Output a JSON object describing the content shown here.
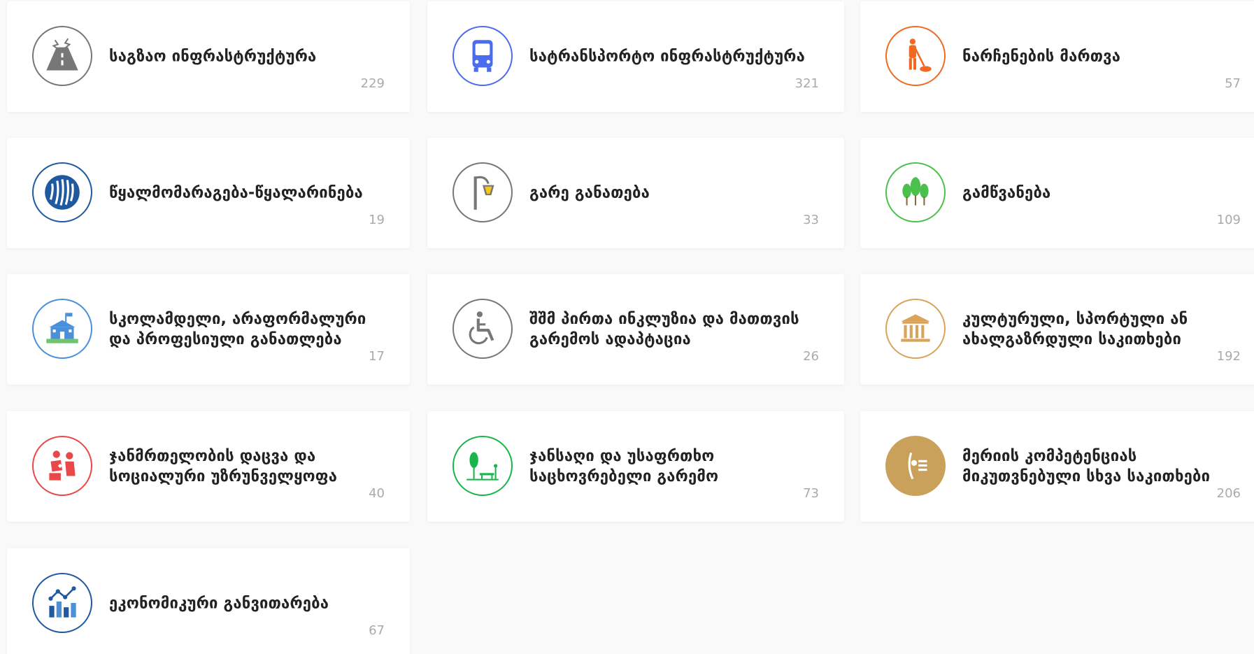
{
  "categories": [
    {
      "label": "საგზაო ინფრასტრუქტურა",
      "count": "229",
      "icon": "road-icon",
      "color": "#777777"
    },
    {
      "label": "სატრანსპორტო ინფრასტრუქტურა",
      "count": "321",
      "icon": "bus-icon",
      "color": "#4a6cf0"
    },
    {
      "label": "ნარჩენების მართვა",
      "count": "57",
      "icon": "janitor-icon",
      "color": "#f26a21"
    },
    {
      "label": "წყალმომარაგება-წყალარინება",
      "count": "19",
      "icon": "water-icon",
      "color": "#1f5aa0"
    },
    {
      "label": "გარე განათება",
      "count": "33",
      "icon": "street-lamp-icon",
      "color": "#777777"
    },
    {
      "label": "გამწვანება",
      "count": "109",
      "icon": "trees-icon",
      "color": "#4cc04c"
    },
    {
      "label": "სკოლამდელი, არაფორმალური და პროფესიული განათლება",
      "count": "17",
      "icon": "school-icon",
      "color": "#4a90d9"
    },
    {
      "label": "შშმ პირთა ინკლუზია და მათთვის გარემოს ადაპტაცია",
      "count": "26",
      "icon": "wheelchair-icon",
      "color": "#777777"
    },
    {
      "label": "კულტურული, სპორტული ან ახალგაზრდული საკითხები",
      "count": "192",
      "icon": "museum-icon",
      "color": "#d9a45a"
    },
    {
      "label": "ჯანმრთელობის დაცვა და სოციალური უზრუნველყოფა",
      "count": "40",
      "icon": "care-icon",
      "color": "#e84848"
    },
    {
      "label": "ჯანსაღი და უსაფრთხო საცხოვრებელი გარემო",
      "count": "73",
      "icon": "park-icon",
      "color": "#1ab54a"
    },
    {
      "label": "მერიის კომპეტენციას მიკუთვნებული სხვა საკითხები",
      "count": "206",
      "icon": "city-seal-icon",
      "color": "#c9a15a"
    },
    {
      "label": "ეკონომიკური განვითარება",
      "count": "67",
      "icon": "chart-icon",
      "color": "#1f5aa0"
    }
  ]
}
